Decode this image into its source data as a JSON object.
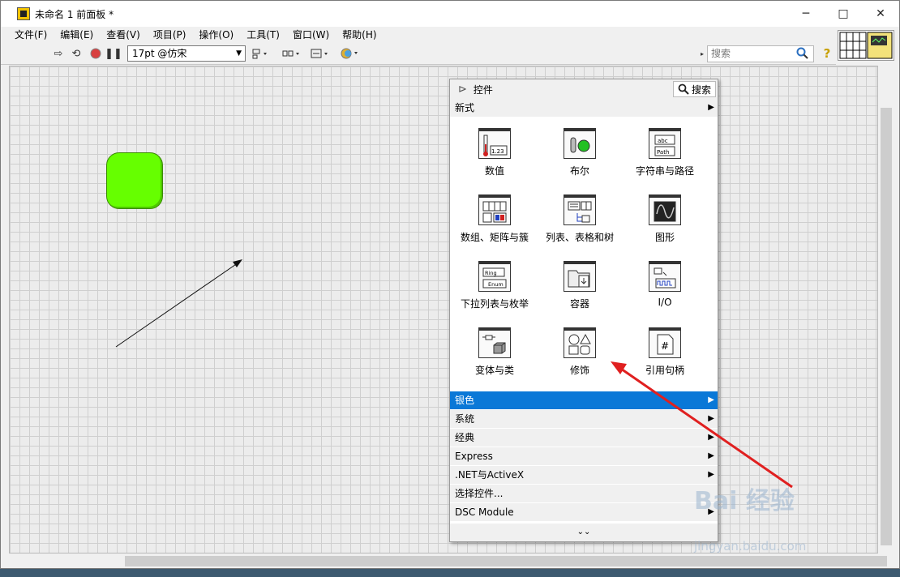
{
  "window": {
    "title": "未命名 1 前面板 *",
    "controls": [
      "─",
      "□",
      "✕"
    ]
  },
  "menu": [
    "文件(F)",
    "编辑(E)",
    "查看(V)",
    "项目(P)",
    "操作(O)",
    "工具(T)",
    "窗口(W)",
    "帮助(H)"
  ],
  "toolbar": {
    "font": "17pt @仿宋",
    "search_placeholder": "搜索",
    "help": "?"
  },
  "palette": {
    "title": "控件",
    "search_label": "搜索",
    "top_category": "新式",
    "items": [
      {
        "label": "数值",
        "icon": "numeric-icon"
      },
      {
        "label": "布尔",
        "icon": "boolean-icon"
      },
      {
        "label": "字符串与路径",
        "icon": "string-path-icon"
      },
      {
        "label": "数组、矩阵与簇",
        "icon": "array-matrix-cluster-icon"
      },
      {
        "label": "列表、表格和树",
        "icon": "list-table-tree-icon"
      },
      {
        "label": "图形",
        "icon": "graph-icon"
      },
      {
        "label": "下拉列表与枚举",
        "icon": "ring-enum-icon"
      },
      {
        "label": "容器",
        "icon": "container-icon"
      },
      {
        "label": "I/O",
        "icon": "io-icon"
      },
      {
        "label": "变体与类",
        "icon": "variant-class-icon"
      },
      {
        "label": "修饰",
        "icon": "decorations-icon"
      },
      {
        "label": "引用句柄",
        "icon": "refnum-icon"
      }
    ],
    "categories": [
      {
        "label": "银色",
        "selected": true
      },
      {
        "label": "系统"
      },
      {
        "label": "经典"
      },
      {
        "label": "Express"
      },
      {
        "label": ".NET与ActiveX"
      },
      {
        "label": "选择控件..."
      },
      {
        "label": "DSC Module"
      }
    ],
    "icon_glyphs": {
      "numeric": "1.23",
      "string": "abc",
      "path": "Path",
      "ring": "Ring",
      "enum": "Enum"
    }
  },
  "watermark": {
    "brand": "Bai 经验",
    "url": "jingyan.baidu.com"
  },
  "colors": {
    "led": "#66ff00",
    "selection": "#0a78d7",
    "annotation_arrow": "#e02020"
  }
}
